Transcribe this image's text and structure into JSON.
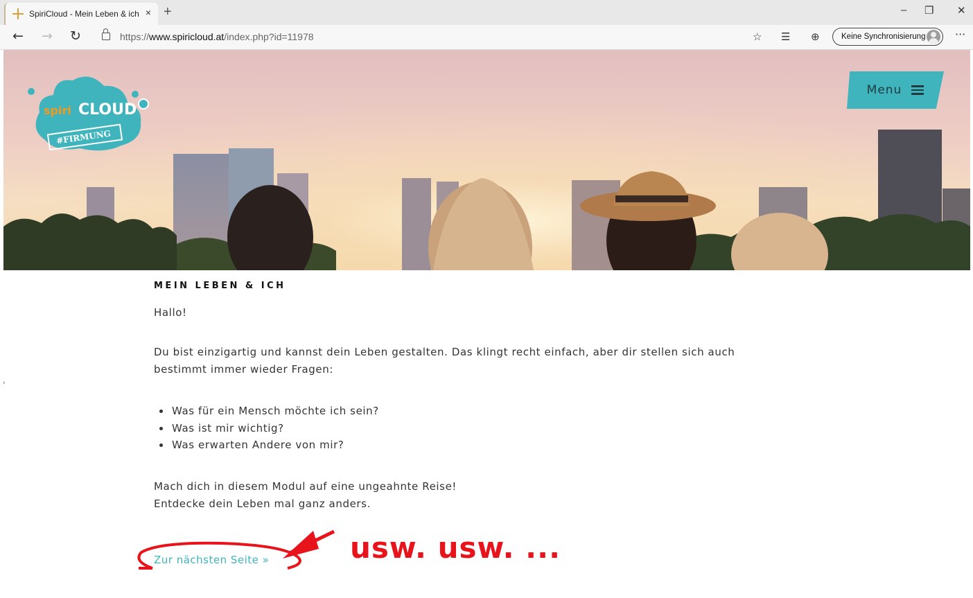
{
  "browser": {
    "tab_title": "SpiriCloud - Mein Leben & ich",
    "tab_close": "×",
    "new_tab": "+",
    "minimize": "–",
    "restore": "❐",
    "close": "✕",
    "back": "←",
    "forward": "→",
    "reload": "↻",
    "url_prefix": "https://",
    "url_domain": "www.spiricloud.at",
    "url_path": "/index.php?id=11978",
    "favorite_icon": "☆",
    "favorites_icon": "☰",
    "collections_icon": "⊕",
    "sync_label": "Keine Synchronisierung",
    "more": "···"
  },
  "site": {
    "logo": {
      "word1": "spiri",
      "word2": "CLOUD",
      "tag": "#FIRMUNG"
    },
    "menu_label": "Menu"
  },
  "article": {
    "heading": "MEIN LEBEN & ICH",
    "greeting": "Hallo!",
    "intro_line1": "Du bist einzigartig und kannst dein Leben gestalten. Das klingt recht einfach, aber dir stellen sich auch",
    "intro_line2": "bestimmt immer wieder Fragen:",
    "questions": [
      "Was für ein Mensch möchte ich sein?",
      "Was ist mir wichtig?",
      "Was erwarten Andere von mir?"
    ],
    "outro_line1": "Mach dich in diesem Modul auf eine ungeahnte Reise!",
    "outro_line2": "Entdecke dein Leben mal ganz anders.",
    "next_link": "Zur nächsten Seite »"
  },
  "annotation": {
    "text": "usw. usw. ...",
    "color": "#e8141c"
  },
  "colors": {
    "accent": "#3fb4bd",
    "logo_orange": "#f39a1e"
  }
}
